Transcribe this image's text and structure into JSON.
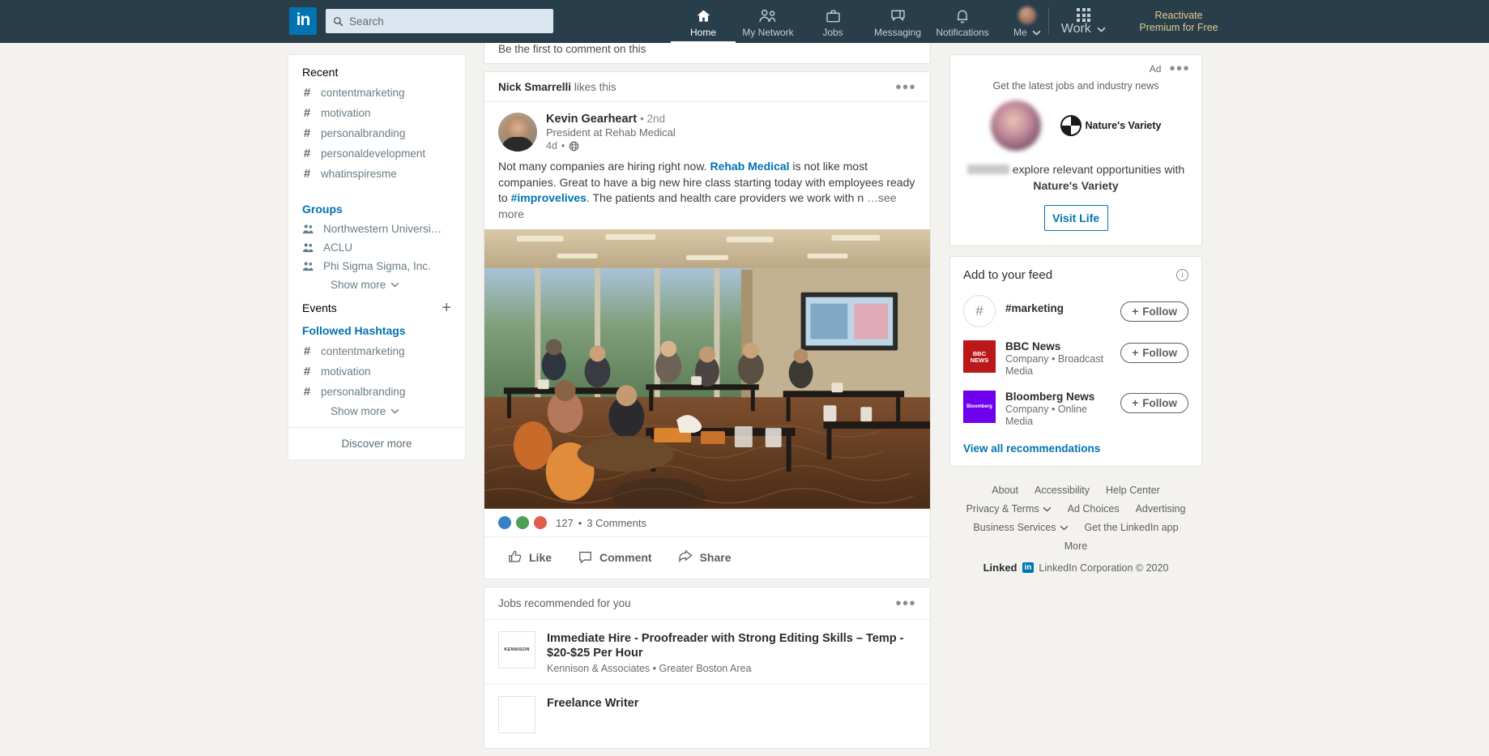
{
  "nav": {
    "logo": "in",
    "search_placeholder": "Search",
    "items": [
      {
        "label": "Home",
        "icon": "home-icon",
        "active": true
      },
      {
        "label": "My Network",
        "icon": "people-icon",
        "active": false
      },
      {
        "label": "Jobs",
        "icon": "briefcase-icon",
        "active": false
      },
      {
        "label": "Messaging",
        "icon": "message-icon",
        "active": false
      },
      {
        "label": "Notifications",
        "icon": "bell-icon",
        "active": false
      },
      {
        "label": "Me",
        "icon": "avatar-icon",
        "active": false
      }
    ],
    "work_label": "Work",
    "premium_line1": "Reactivate",
    "premium_line2": "Premium for Free"
  },
  "left_rail": {
    "recent_title": "Recent",
    "recent": [
      "contentmarketing",
      "motivation",
      "personalbranding",
      "personaldevelopment",
      "whatinspiresme"
    ],
    "groups_title": "Groups",
    "groups": [
      "Northwestern University Alu…",
      "ACLU",
      "Phi Sigma Sigma, Inc."
    ],
    "groups_show_more": "Show more",
    "events_title": "Events",
    "events_add": "+",
    "hashtags_title": "Followed Hashtags",
    "hashtags": [
      "contentmarketing",
      "motivation",
      "personalbranding"
    ],
    "hashtags_show_more": "Show more",
    "discover_more": "Discover more"
  },
  "feed": {
    "previous_post_tail": "Be the first to comment on this",
    "post": {
      "social_proof_name": "Nick Smarrelli",
      "social_proof_action": "likes this",
      "author_name": "Kevin Gearheart",
      "author_degree": "• 2nd",
      "author_title": "President at Rehab Medical",
      "post_time": "4d",
      "body_part1": "Not many companies are hiring right now. ",
      "body_link1": "Rehab Medical",
      "body_part2": " is not like most companies. Great to have a big new hire class starting today with employees ready to ",
      "body_link2": "#improvelives",
      "body_part3": ". The patients and health care providers we work with n ",
      "see_more": "…see more",
      "reaction_count": "127",
      "comment_count": "3 Comments",
      "reaction_separator": "•",
      "actions": [
        "Like",
        "Comment",
        "Share"
      ]
    },
    "jobs": {
      "header": "Jobs recommended for you",
      "items": [
        {
          "title": "Immediate Hire - Proofreader with Strong Editing Skills – Temp - $20-$25 Per Hour",
          "company": "Kennison & Associates • Greater Boston Area",
          "logo_text": "KENNISON"
        },
        {
          "title": "Freelance Writer",
          "company": "",
          "logo_text": ""
        }
      ]
    }
  },
  "right_rail": {
    "ad": {
      "label": "Ad",
      "tagline": "Get the latest jobs and industry news",
      "brand": "Nature's Variety",
      "body_pre": "explore relevant opportunities with ",
      "body_brand": "Nature's Variety",
      "cta": "Visit Life"
    },
    "add_to_feed": {
      "title": "Add to your feed",
      "items": [
        {
          "name": "#marketing",
          "desc": "",
          "logo": "hashtag-icon",
          "follow": "Follow"
        },
        {
          "name": "BBC News",
          "desc": "Company • Broadcast Media",
          "logo": "bbc-logo",
          "follow": "Follow"
        },
        {
          "name": "Bloomberg News",
          "desc": "Company • Online Media",
          "logo": "bloomberg-logo",
          "follow": "Follow"
        }
      ],
      "view_all": "View all recommendations"
    },
    "footer": {
      "row1": [
        "About",
        "Accessibility",
        "Help Center"
      ],
      "row2": [
        "Privacy & Terms",
        "Ad Choices",
        "Advertising"
      ],
      "row3": [
        "Business Services",
        "Get the LinkedIn app"
      ],
      "row4": [
        "More"
      ],
      "brand_word": "Linked",
      "brand_in": "in",
      "copyright": "LinkedIn Corporation © 2020"
    }
  }
}
